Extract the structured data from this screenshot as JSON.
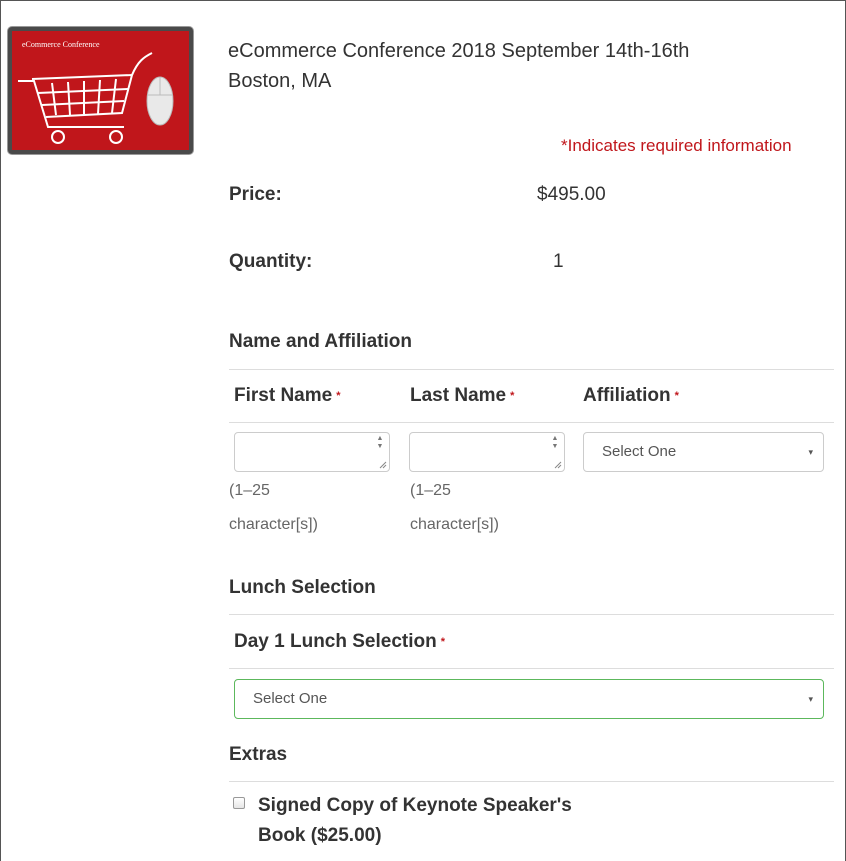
{
  "product": {
    "thumbnail_caption": "eCommerce Conference",
    "title_line1": "eCommerce Conference 2018 September 14th-16th",
    "title_line2": "Boston, MA"
  },
  "required_note": "*Indicates required information",
  "price": {
    "label": "Price:",
    "value": "$495.00"
  },
  "quantity": {
    "label": "Quantity:",
    "value": "1"
  },
  "name_section": {
    "title": "Name and Affiliation",
    "first_name": {
      "label": "First Name",
      "hint_line1": "(1–25",
      "hint_line2": "character[s])",
      "value": ""
    },
    "last_name": {
      "label": "Last Name",
      "hint_line1": "(1–25",
      "hint_line2": "character[s])",
      "value": ""
    },
    "affiliation": {
      "label": "Affiliation",
      "selected": "Select One"
    },
    "required_marker": "*"
  },
  "lunch_section": {
    "title": "Lunch Selection",
    "day1": {
      "label": "Day 1 Lunch Selection",
      "selected": "Select One"
    }
  },
  "extras_section": {
    "title": "Extras",
    "items": [
      {
        "label_line1": "Signed Copy of Keynote Speaker's",
        "label_line2": "Book ($25.00)",
        "checked": false
      }
    ]
  },
  "icons": {
    "caret": "▾",
    "spinner_up": "▲",
    "spinner_down": "▼"
  },
  "colors": {
    "required_red": "#c0161b",
    "thumbnail_red": "#c0161b",
    "focus_green": "#5cb85c"
  }
}
